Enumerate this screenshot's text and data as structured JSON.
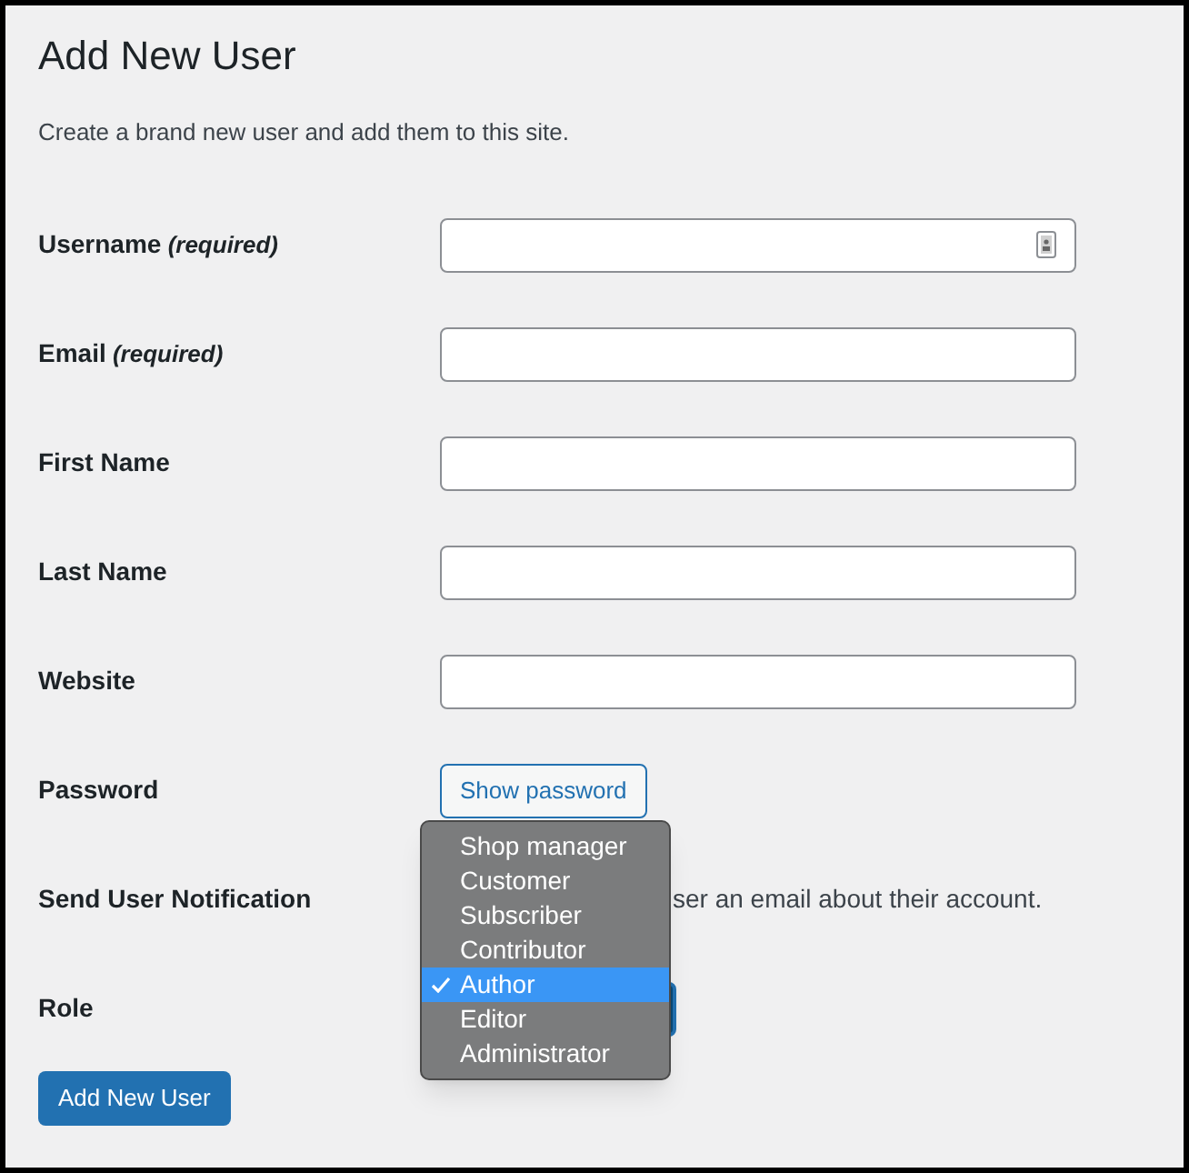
{
  "title": "Add New User",
  "description": "Create a brand new user and add them to this site.",
  "fields": [
    {
      "label": "Username",
      "note": "(required)",
      "kind": "text",
      "icon": true
    },
    {
      "label": "Email",
      "note": "(required)",
      "kind": "text"
    },
    {
      "label": "First Name",
      "kind": "text"
    },
    {
      "label": "Last Name",
      "kind": "text"
    },
    {
      "label": "Website",
      "kind": "text"
    },
    {
      "label": "Password",
      "kind": "button",
      "button": "Show password"
    },
    {
      "label": "Send User Notification",
      "kind": "notice",
      "text": "ser an email about their account."
    },
    {
      "label": "Role",
      "kind": "select"
    }
  ],
  "role_menu": [
    {
      "label": "Shop manager",
      "selected": false
    },
    {
      "label": "Customer",
      "selected": false
    },
    {
      "label": "Subscriber",
      "selected": false
    },
    {
      "label": "Contributor",
      "selected": false
    },
    {
      "label": "Author",
      "selected": true
    },
    {
      "label": "Editor",
      "selected": false
    },
    {
      "label": "Administrator",
      "selected": false
    }
  ],
  "submit": "Add New User"
}
